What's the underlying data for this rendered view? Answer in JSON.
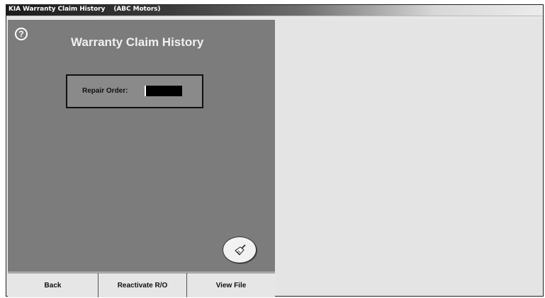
{
  "window": {
    "title": "KIA Warranty Claim History    (ABC Motors)"
  },
  "panel": {
    "heading": "Warranty Claim History",
    "help_icon": "help-icon",
    "repair_order": {
      "label": "Repair Order:",
      "value": ""
    },
    "clear_icon": "broom-icon"
  },
  "buttons": {
    "back": "Back",
    "reactivate": "Reactivate R/O",
    "view_file": "View File"
  },
  "colors": {
    "panel_bg": "#7c7c7c",
    "right_bg": "#e4e4e4",
    "button_bg": "#e6e6e6"
  }
}
